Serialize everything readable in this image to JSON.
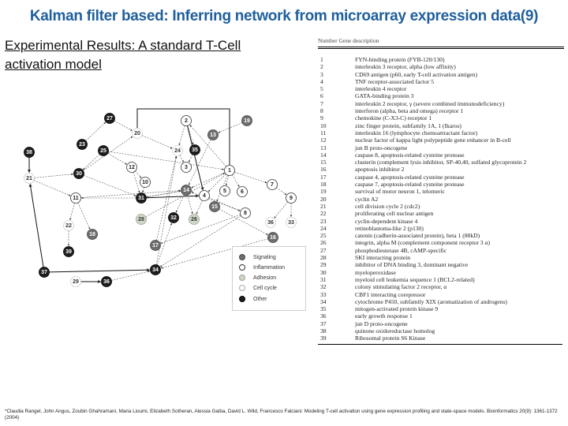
{
  "title": "Kalman filter based: Inferring network from microarray expression data(9)",
  "subtitle": "Experimental Results: A standard T-Cell activation model",
  "network": {
    "categories": {
      "signaling": {
        "label": "Signaling",
        "fill": "#6e6e6e",
        "stroke": "#444444",
        "text": "#ffffff"
      },
      "inflammation": {
        "label": "Inflammation",
        "fill": "#ffffff",
        "stroke": "#333333",
        "text": "#222222"
      },
      "adhesion": {
        "label": "Adhesion",
        "fill": "#cfd8c8",
        "stroke": "#9aa090",
        "text": "#333333"
      },
      "cell_cycle": {
        "label": "Cell cycle",
        "fill": "#ffffff",
        "stroke": "#aaaaaa",
        "text": "#333333"
      },
      "other": {
        "label": "Other",
        "fill": "#1e1e1e",
        "stroke": "#000000",
        "text": "#ffffff"
      }
    },
    "legend_order": [
      "signaling",
      "inflammation",
      "adhesion",
      "cell_cycle",
      "other"
    ],
    "nodes": [
      {
        "id": "27",
        "cat": "other"
      },
      {
        "id": "2",
        "cat": "inflammation"
      },
      {
        "id": "19",
        "cat": "signaling"
      },
      {
        "id": "20",
        "cat": "cell_cycle"
      },
      {
        "id": "13",
        "cat": "signaling"
      },
      {
        "id": "23",
        "cat": "other"
      },
      {
        "id": "25",
        "cat": "other"
      },
      {
        "id": "24",
        "cat": "cell_cycle"
      },
      {
        "id": "35",
        "cat": "other"
      },
      {
        "id": "38",
        "cat": "other"
      },
      {
        "id": "3",
        "cat": "inflammation"
      },
      {
        "id": "1",
        "cat": "inflammation"
      },
      {
        "id": "21",
        "cat": "cell_cycle"
      },
      {
        "id": "30",
        "cat": "other"
      },
      {
        "id": "12",
        "cat": "inflammation"
      },
      {
        "id": "10",
        "cat": "inflammation"
      },
      {
        "id": "7",
        "cat": "inflammation"
      },
      {
        "id": "11",
        "cat": "inflammation"
      },
      {
        "id": "31",
        "cat": "other"
      },
      {
        "id": "14",
        "cat": "signaling"
      },
      {
        "id": "4",
        "cat": "inflammation"
      },
      {
        "id": "5",
        "cat": "inflammation"
      },
      {
        "id": "6",
        "cat": "inflammation"
      },
      {
        "id": "9",
        "cat": "inflammation"
      },
      {
        "id": "15",
        "cat": "signaling"
      },
      {
        "id": "28",
        "cat": "adhesion"
      },
      {
        "id": "32",
        "cat": "other"
      },
      {
        "id": "26",
        "cat": "adhesion"
      },
      {
        "id": "8",
        "cat": "inflammation"
      },
      {
        "id": "36",
        "cat": "cell_cycle"
      },
      {
        "id": "33",
        "cat": "cell_cycle"
      },
      {
        "id": "22",
        "cat": "cell_cycle"
      },
      {
        "id": "18",
        "cat": "signaling"
      },
      {
        "id": "16",
        "cat": "signaling"
      },
      {
        "id": "17",
        "cat": "signaling"
      },
      {
        "id": "39",
        "cat": "other"
      },
      {
        "id": "37",
        "cat": "other"
      },
      {
        "id": "34",
        "cat": "other"
      },
      {
        "id": "29",
        "cat": "cell_cycle"
      },
      {
        "id": "36b",
        "label": "36",
        "cat": "other"
      }
    ],
    "edges": [
      [
        "27",
        "20",
        "dash"
      ],
      [
        "23",
        "27",
        "dash"
      ],
      [
        "20",
        "24",
        "dash"
      ],
      [
        "2",
        "24",
        "dash"
      ],
      [
        "2",
        "35",
        "dash"
      ],
      [
        "2",
        "4",
        "solid"
      ],
      [
        "19",
        "13",
        "dash"
      ],
      [
        "13",
        "14",
        "dash"
      ],
      [
        "1",
        "2",
        "dash"
      ],
      [
        "1",
        "14",
        "dash"
      ],
      [
        "1",
        "4",
        "dash"
      ],
      [
        "1",
        "15",
        "dash"
      ],
      [
        "1",
        "5",
        "dash"
      ],
      [
        "1",
        "6",
        "dash"
      ],
      [
        "1",
        "7",
        "dash"
      ],
      [
        "7",
        "9",
        "dash"
      ],
      [
        "9",
        "36",
        "dash"
      ],
      [
        "9",
        "33",
        "dash"
      ],
      [
        "38",
        "21",
        "solid"
      ],
      [
        "21",
        "30",
        "dash"
      ],
      [
        "21",
        "11",
        "dash"
      ],
      [
        "30",
        "20",
        "dash"
      ],
      [
        "30",
        "31",
        "dash"
      ],
      [
        "25",
        "30",
        "dash"
      ],
      [
        "25",
        "12",
        "dash"
      ],
      [
        "25",
        "1",
        "dash"
      ],
      [
        "12",
        "31",
        "dash"
      ],
      [
        "12",
        "10",
        "dash"
      ],
      [
        "10",
        "31",
        "dash"
      ],
      [
        "24",
        "3",
        "dash"
      ],
      [
        "35",
        "3",
        "dash"
      ],
      [
        "31",
        "14",
        "dash"
      ],
      [
        "14",
        "31",
        "dash"
      ],
      [
        "31",
        "4",
        "solid"
      ],
      [
        "14",
        "32",
        "dash"
      ],
      [
        "14",
        "26",
        "dash"
      ],
      [
        "4",
        "26",
        "dash"
      ],
      [
        "4",
        "8",
        "dash"
      ],
      [
        "8",
        "14",
        "dash"
      ],
      [
        "8",
        "17",
        "dash"
      ],
      [
        "8",
        "34",
        "dash"
      ],
      [
        "15",
        "16",
        "dash"
      ],
      [
        "16",
        "34",
        "dash"
      ],
      [
        "11",
        "22",
        "dash"
      ],
      [
        "11",
        "18",
        "dash"
      ],
      [
        "22",
        "39",
        "dash"
      ],
      [
        "37",
        "21",
        "solid"
      ],
      [
        "37",
        "34",
        "solid"
      ],
      [
        "29",
        "36b",
        "solid"
      ],
      [
        "36b",
        "34",
        "dash"
      ],
      [
        "34",
        "32",
        "dash"
      ],
      [
        "17",
        "24",
        "dash"
      ],
      [
        "28",
        "1",
        "dash"
      ],
      [
        "31",
        "11",
        "dash"
      ],
      [
        "11",
        "14",
        "dash"
      ],
      [
        "34",
        "24",
        "dash"
      ]
    ]
  },
  "table": {
    "header": "Number  Gene description",
    "rows": [
      {
        "num": "1",
        "desc": "FYN-binding protein (FYB-120/130)"
      },
      {
        "num": "2",
        "desc": "interleukin 3 receptor, alpha (low affinity)"
      },
      {
        "num": "3",
        "desc": "CD69 antigen (p60, early T-cell activation antigen)"
      },
      {
        "num": "4",
        "desc": "TNF receptor-associated factor 5"
      },
      {
        "num": "5",
        "desc": "interleukin 4 receptor"
      },
      {
        "num": "6",
        "desc": "GATA-binding protein 3"
      },
      {
        "num": "7",
        "desc": "interleukin 2 receptor, γ (severe combined immunodeficiency)"
      },
      {
        "num": "8",
        "desc": "interferon (alpha, beta and omega) receptor 1"
      },
      {
        "num": "9",
        "desc": "chemokine (C-X3-C) receptor 1"
      },
      {
        "num": "10",
        "desc": "zinc finger protein, subfamily 1A, 1 (Ikaros)"
      },
      {
        "num": "11",
        "desc": "interleukin 16 (lymphocyte chemoattractant factor)"
      },
      {
        "num": "12",
        "desc": "nuclear factor of kappa light polypeptide gene enhancer in B-cell"
      },
      {
        "num": "13",
        "desc": "jun B proto-oncogene"
      },
      {
        "num": "14",
        "desc": "caspase 8, apoptosis-related cysteine protease"
      },
      {
        "num": "15",
        "desc": "clusterin (complement lysis inhibitor, SP-40,40, sulfated glycoprotein 2"
      },
      {
        "num": "16",
        "desc": "apoptosis inhibitor 2"
      },
      {
        "num": "17",
        "desc": "caspase 4, apoptosis-related cysteine protease"
      },
      {
        "num": "18",
        "desc": "caspase 7, apoptosis-related cysteine protease"
      },
      {
        "num": "19",
        "desc": "survival of motor neuron 1, telomeric"
      },
      {
        "num": "20",
        "desc": "cyclin A2"
      },
      {
        "num": "21",
        "desc": "cell division cycle 2 (cdc2)"
      },
      {
        "num": "22",
        "desc": "proliferating cell nuclear antigen"
      },
      {
        "num": "23",
        "desc": "cyclin-dependent kinase 4"
      },
      {
        "num": "24",
        "desc": "retinoblastoma-like 2 (p130)"
      },
      {
        "num": "25",
        "desc": "catenin (cadherin-associated protein), beta 1 (88kD)"
      },
      {
        "num": "26",
        "desc": "integrin, alpha M (complement component receptor 3 α)"
      },
      {
        "num": "27",
        "desc": "phosphodiesterase 4B, cAMP-specific"
      },
      {
        "num": "28",
        "desc": "SKI interacting protein"
      },
      {
        "num": "29",
        "desc": "inhibitor of DNA binding 3, dominant negative"
      },
      {
        "num": "30",
        "desc": "myeloperoxidase"
      },
      {
        "num": "31",
        "desc": "myeloid cell leukemia sequence 1 (BCL2-related)"
      },
      {
        "num": "32",
        "desc": "colony stimulating factor 2 receptor, α"
      },
      {
        "num": "33",
        "desc": "CBF1 interacting corepressor"
      },
      {
        "num": "34",
        "desc": "cytochrome P450, subfamily XIX (aromatization of androgens)"
      },
      {
        "num": "35",
        "desc": "mitogen-activated protein kinase 9"
      },
      {
        "num": "36",
        "desc": "early growth response 1"
      },
      {
        "num": "37",
        "desc": "jun D proto-oncogene"
      },
      {
        "num": "38",
        "desc": "quinone oxidoreductase homolog"
      },
      {
        "num": "39",
        "desc": "Ribosomal protein S6 Kinase"
      }
    ]
  },
  "citation": "*Claudia Rangel, John Angus, Zoubin Ghahramani, Maria Lioumi, Elizabeth Sotheran, Alessia Gaiba, David L. Wild, Francesco Falciani: Modeling T-cell activation using gene expression profiling and state-space models. Bioinformatics 20(9): 1361-1372 (2004)"
}
